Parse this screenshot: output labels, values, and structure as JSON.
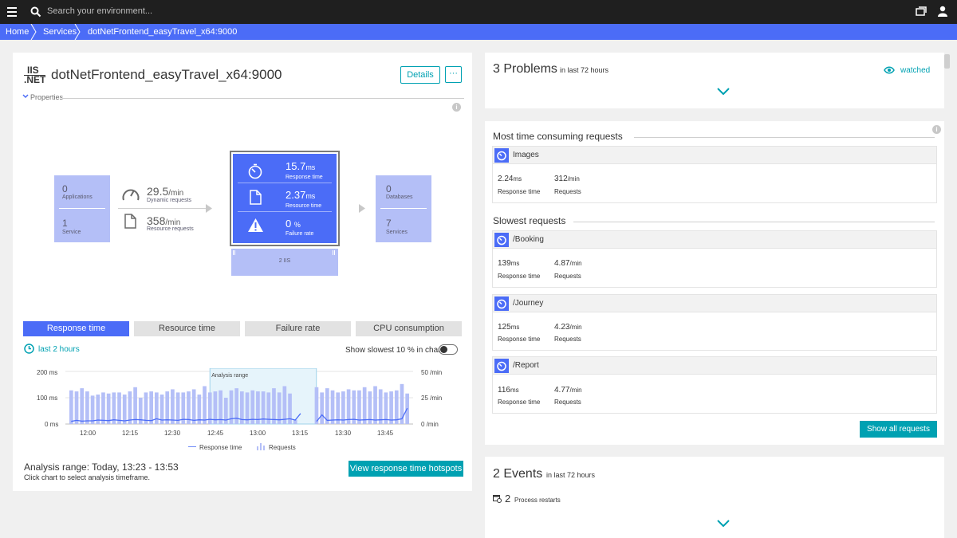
{
  "topbar": {
    "search_placeholder": "Search your environment..."
  },
  "breadcrumb": [
    "Home",
    "Services",
    "dotNetFrontend_easyTravel_x64:9000"
  ],
  "service": {
    "logo_top": "IIS",
    "logo_bottom": ".NET",
    "title": "dotNetFrontend_easyTravel_x64:9000",
    "details_label": "Details",
    "more_label": "···",
    "properties_label": "Properties"
  },
  "flow": {
    "callers": {
      "applications_count": "0",
      "applications_label": "Applications",
      "service_count": "1",
      "service_label": "Service"
    },
    "dynamic_requests": {
      "value": "29.5",
      "unit": "/min",
      "label": "Dynamic requests"
    },
    "resource_requests": {
      "value": "358",
      "unit": "/min",
      "label": "Resource requests"
    },
    "metrics": {
      "response_time": {
        "value": "15.7",
        "unit": "ms",
        "label": "Response time"
      },
      "resource_time": {
        "value": "2.37",
        "unit": "ms",
        "label": "Resource time"
      },
      "failure_rate": {
        "value": "0",
        "unit": "%",
        "label": "Failure rate"
      }
    },
    "instances": "2 IIS",
    "callees": {
      "databases_count": "0",
      "databases_label": "Databases",
      "services_count": "7",
      "services_label": "Services"
    }
  },
  "tabs": [
    "Response time",
    "Resource time",
    "Failure rate",
    "CPU consumption"
  ],
  "timeframe": "last 2 hours",
  "slowest_toggle": "Show slowest 10 % in chart",
  "chart_data": {
    "type": "bar",
    "y_left_ticks": [
      "200 ms",
      "100 ms",
      "0 ms"
    ],
    "y_right_ticks": [
      "50 /min",
      "25 /min",
      "0 /min"
    ],
    "x_ticks": [
      "12:00",
      "12:15",
      "12:30",
      "12:45",
      "13:00",
      "13:15",
      "13:30",
      "13:45"
    ],
    "analysis_range_label": "Analysis range",
    "analysis_range_span": [
      26.5,
      34.5
    ],
    "ylim_left": [
      0,
      200
    ],
    "ylim_right": [
      0,
      50
    ],
    "legend": [
      "Response time",
      "Requests"
    ],
    "series": [
      {
        "name": "Requests",
        "axis": "right",
        "values": [
          32,
          31,
          34,
          31,
          27,
          28,
          30,
          29,
          30,
          30,
          28,
          31,
          35,
          25,
          30,
          31,
          30,
          28,
          31,
          33,
          30,
          30,
          31,
          33,
          28,
          36,
          30,
          31,
          32,
          25,
          32,
          34,
          31,
          30,
          32,
          31,
          31,
          30,
          34,
          30,
          36,
          29,
          4,
          0,
          0,
          0,
          35,
          30,
          34,
          32,
          30,
          31,
          33,
          32,
          32,
          35,
          31,
          36,
          33,
          30,
          31,
          32,
          38,
          29
        ]
      },
      {
        "name": "Response time",
        "axis": "left",
        "values": [
          10,
          14,
          11,
          12,
          12,
          15,
          14,
          13,
          16,
          14,
          12,
          15,
          17,
          16,
          14,
          13,
          20,
          15,
          16,
          15,
          14,
          18,
          17,
          14,
          16,
          15,
          18,
          16,
          17,
          15,
          20,
          22,
          17,
          16,
          18,
          17,
          19,
          18,
          17,
          16,
          18,
          20,
          15,
          40,
          null,
          null,
          10,
          35,
          14,
          15,
          16,
          15,
          17,
          18,
          15,
          16,
          17,
          15,
          16,
          17,
          15,
          16,
          20,
          60
        ]
      }
    ]
  },
  "analysis": {
    "title": "Analysis range: Today, 13:23 - 13:53",
    "hint": "Click chart to select analysis timeframe.",
    "hotspots_button": "View response time hotspots"
  },
  "problems": {
    "count_title": "3 Problems",
    "period": "in last 72 hours",
    "watched": "watched"
  },
  "most_time": {
    "title": "Most time consuming requests",
    "items": [
      {
        "name": "Images",
        "response": "2.24",
        "response_unit": "ms",
        "requests": "312",
        "requests_unit": "/min"
      }
    ]
  },
  "slowest": {
    "title": "Slowest requests",
    "items": [
      {
        "name": "/Booking",
        "response": "139",
        "response_unit": "ms",
        "requests": "4.87",
        "requests_unit": "/min"
      },
      {
        "name": "/Journey",
        "response": "125",
        "response_unit": "ms",
        "requests": "4.23",
        "requests_unit": "/min"
      },
      {
        "name": "/Report",
        "response": "116",
        "response_unit": "ms",
        "requests": "4.77",
        "requests_unit": "/min"
      }
    ]
  },
  "labels": {
    "response_time": "Response time",
    "requests": "Requests"
  },
  "show_all_button": "Show all requests",
  "events": {
    "count_title": "2 Events",
    "period": "in last 72 hours",
    "item_count": "2",
    "item_label": "Process restarts"
  },
  "colors": {
    "accent": "#4b6cf7",
    "teal": "#00a1b2",
    "topbar": "#1f1f1f",
    "lavender": "#b4bff7"
  }
}
